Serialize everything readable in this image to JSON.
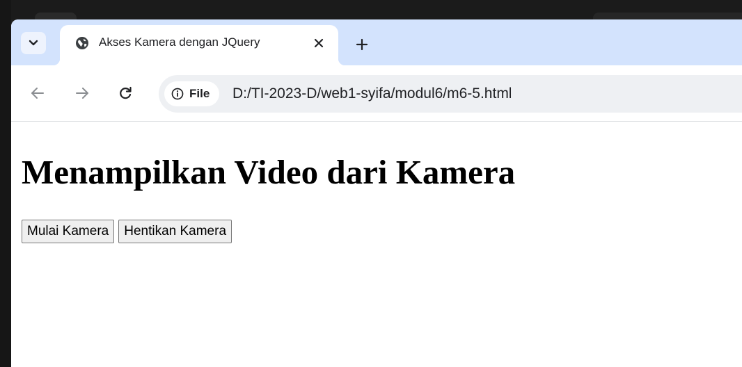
{
  "browser": {
    "tab": {
      "title": "Akses Kamera dengan JQuery",
      "favicon": "globe-icon",
      "close_icon": "close-icon"
    },
    "tab_search_icon": "chevron-down-icon",
    "new_tab_icon": "plus-icon",
    "nav": {
      "back_icon": "arrow-left-icon",
      "forward_icon": "arrow-right-icon",
      "reload_icon": "reload-icon"
    },
    "omnibox": {
      "chip_icon": "info-icon",
      "chip_label": "File",
      "url": "D:/TI-2023-D/web1-syifa/modul6/m6-5.html"
    }
  },
  "page": {
    "heading": "Menampilkan Video dari Kamera",
    "buttons": {
      "start": "Mulai Kamera",
      "stop": "Hentikan Kamera"
    }
  },
  "colors": {
    "tabstrip": "#d3e3fd",
    "omnibox": "#eef0f3"
  }
}
